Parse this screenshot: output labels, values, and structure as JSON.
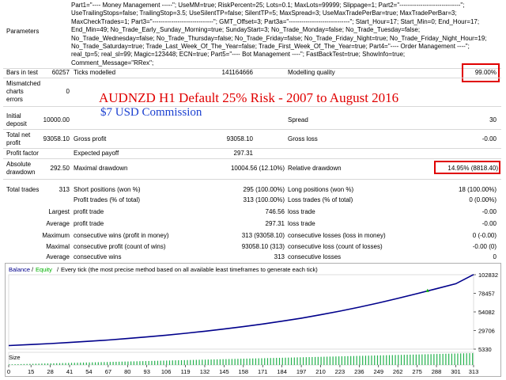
{
  "parameters": {
    "label": "Parameters",
    "lines": [
      "Part1=\"---- Money Management -----\"; UseMM=true; RiskPercent=25; Lots=0.1; MaxLots=99999; Slippage=1; Part2=\"-----------------------------\";",
      "UseTrailingStops=false; TrailingStop=3.5; UseSilentTP=false; SilentTP=5; MaxSpread=3; UseMaxTradePerBar=true; MaxTradePerBar=3;",
      "MaxCheckTrades=1; Part3=\"-----------------------------\"; GMT_Offset=3; Part3a=\"-----------------------------\"; Start_Hour=17; Start_Min=0; End_Hour=17;",
      "End_Min=49; No_Trade_Early_Sunday_Morning=true; SundayStart=3; No_Trade_Monday=false; No_Trade_Tuesday=false;",
      "No_Trade_Wednesday=false; No_Trade_Thursday=false; No_Trade_Friday=false; No_Trade_Friday_Night=true; No_Trade_Friday_Night_Hour=19;",
      "No_Trade_Saturday=true; Trade_Last_Week_Of_The_Year=false; Trade_First_Week_Of_The_Year=true; Part4=\"---- Order Management ----\";",
      "real_tp=5; real_sl=99; Magic=123448; ECN=true; Part5=\"---- Bot Management ----\"; FastBackTest=true; ShowInfo=true;",
      "Comment_Message=\"RRex\";"
    ]
  },
  "stats": {
    "bars_label": "Bars in test",
    "bars_value": "60257",
    "ticks_label": "Ticks modelled",
    "ticks_value": "141164666",
    "quality_label": "Modelling quality",
    "quality_value": "99.00%",
    "mismatch_label_1": "Mismatched",
    "mismatch_label_2": "charts",
    "mismatch_label_3": "errors",
    "mismatch_value": "0",
    "initial_label_1": "Initial",
    "initial_label_2": "deposit",
    "initial_value": "10000.00",
    "spread_label": "Spread",
    "spread_value": "30",
    "net_label_1": "Total net",
    "net_label_2": "profit",
    "net_value": "93058.10",
    "gross_profit_label": "Gross profit",
    "gross_profit_value": "93058.10",
    "gross_loss_label": "Gross loss",
    "gross_loss_value": "-0.00",
    "pf_label": "Profit factor",
    "pf_value": "",
    "payoff_label": "Expected payoff",
    "payoff_value": "297.31",
    "abs_dd_label_1": "Absolute",
    "abs_dd_label_2": "drawdown",
    "abs_dd_value": "292.50",
    "max_dd_label": "Maximal drawdown",
    "max_dd_value": "10004.56 (12.10%)",
    "rel_dd_label": "Relative drawdown",
    "rel_dd_value": "14.95% (8818.40)",
    "total_trades_label": "Total trades",
    "total_trades_value": "313",
    "short_label": "Short positions (won %)",
    "short_value": "295 (100.00%)",
    "long_label": "Long positions (won %)",
    "long_value": "18 (100.00%)",
    "profit_trades_label": "Profit trades (% of total)",
    "profit_trades_value": "313 (100.00%)",
    "loss_trades_label": "Loss trades (% of total)",
    "loss_trades_value": "0 (0.00%)",
    "largest_label": "Largest",
    "largest_profit_label": "profit trade",
    "largest_profit_value": "746.56",
    "largest_loss_label": "loss trade",
    "largest_loss_value": "-0.00",
    "average_label": "Average",
    "average_profit_label": "profit trade",
    "average_profit_value": "297.31",
    "average_loss_label": "loss trade",
    "average_loss_value": "-0.00",
    "maximum_label": "Maximum",
    "max_cons_wins_label": "consecutive wins (profit in money)",
    "max_cons_wins_value": "313 (93058.10)",
    "max_cons_losses_label": "consecutive losses (loss in money)",
    "max_cons_losses_value": "0 (-0.00)",
    "maximal_label": "Maximal",
    "maximal_profit_label": "consecutive profit (count of wins)",
    "maximal_profit_value": "93058.10 (313)",
    "maximal_loss_label": "consecutive loss (count of losses)",
    "maximal_loss_value": "-0.00 (0)",
    "avg_cons_label": "Average",
    "avg_cons_wins_label": "consecutive wins",
    "avg_cons_wins_value": "313",
    "avg_cons_losses_label": "consecutive losses",
    "avg_cons_losses_value": "0"
  },
  "overlay": {
    "title": "AUDNZD H1 Default 25% Risk - 2007 to August 2016",
    "subtitle": "$7 USD Commission"
  },
  "chart_data": {
    "type": "line",
    "legend": {
      "balance": "Balance",
      "sep": "/",
      "equity": "Equity",
      "sep2": "/",
      "text": "Every tick (the most precise method based on all available least timeframes to generate each tick)"
    },
    "size_label": "Size",
    "y_ticks": [
      "102832",
      "78457",
      "54082",
      "29706",
      "5330"
    ],
    "ylim": [
      5330,
      102832
    ],
    "x_ticks": [
      "0",
      "15",
      "28",
      "41",
      "54",
      "67",
      "80",
      "93",
      "106",
      "119",
      "132",
      "145",
      "158",
      "171",
      "184",
      "197",
      "210",
      "223",
      "236",
      "249",
      "262",
      "275",
      "288",
      "301",
      "313"
    ],
    "xlim": [
      0,
      313
    ],
    "series": [
      {
        "name": "Balance",
        "color": "#00008b",
        "x": [
          0,
          15,
          28,
          41,
          54,
          67,
          80,
          93,
          106,
          119,
          132,
          145,
          158,
          171,
          184,
          197,
          210,
          223,
          236,
          249,
          262,
          275,
          288,
          301,
          313
        ],
        "values": [
          10000,
          11300,
          12600,
          14000,
          15600,
          17300,
          19200,
          21300,
          23600,
          26100,
          28800,
          31700,
          34800,
          38200,
          41900,
          45900,
          50300,
          55100,
          60300,
          65900,
          71800,
          78000,
          84500,
          91000,
          103058
        ]
      },
      {
        "name": "Equity",
        "color": "#00b000",
        "x": [
          282
        ],
        "values": [
          82400
        ]
      }
    ],
    "size_series": {
      "name": "Size",
      "color": "#22b14c",
      "range": [
        1,
        95
      ]
    }
  }
}
